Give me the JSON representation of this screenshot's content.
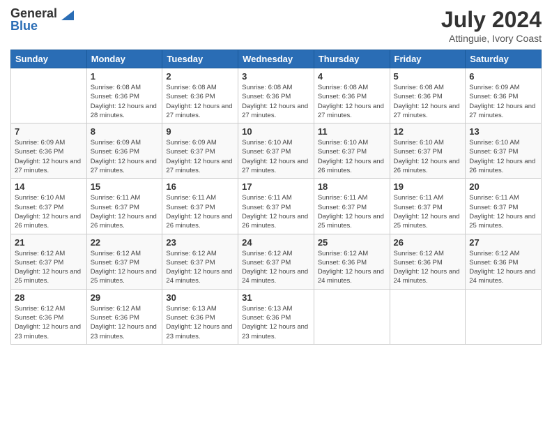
{
  "header": {
    "logo_general": "General",
    "logo_blue": "Blue",
    "month_year": "July 2024",
    "location": "Attinguie, Ivory Coast"
  },
  "calendar": {
    "days_of_week": [
      "Sunday",
      "Monday",
      "Tuesday",
      "Wednesday",
      "Thursday",
      "Friday",
      "Saturday"
    ],
    "weeks": [
      [
        {
          "day": "",
          "sunrise": "",
          "sunset": "",
          "daylight": ""
        },
        {
          "day": "1",
          "sunrise": "Sunrise: 6:08 AM",
          "sunset": "Sunset: 6:36 PM",
          "daylight": "Daylight: 12 hours and 28 minutes."
        },
        {
          "day": "2",
          "sunrise": "Sunrise: 6:08 AM",
          "sunset": "Sunset: 6:36 PM",
          "daylight": "Daylight: 12 hours and 27 minutes."
        },
        {
          "day": "3",
          "sunrise": "Sunrise: 6:08 AM",
          "sunset": "Sunset: 6:36 PM",
          "daylight": "Daylight: 12 hours and 27 minutes."
        },
        {
          "day": "4",
          "sunrise": "Sunrise: 6:08 AM",
          "sunset": "Sunset: 6:36 PM",
          "daylight": "Daylight: 12 hours and 27 minutes."
        },
        {
          "day": "5",
          "sunrise": "Sunrise: 6:08 AM",
          "sunset": "Sunset: 6:36 PM",
          "daylight": "Daylight: 12 hours and 27 minutes."
        },
        {
          "day": "6",
          "sunrise": "Sunrise: 6:09 AM",
          "sunset": "Sunset: 6:36 PM",
          "daylight": "Daylight: 12 hours and 27 minutes."
        }
      ],
      [
        {
          "day": "7",
          "sunrise": "Sunrise: 6:09 AM",
          "sunset": "Sunset: 6:36 PM",
          "daylight": "Daylight: 12 hours and 27 minutes."
        },
        {
          "day": "8",
          "sunrise": "Sunrise: 6:09 AM",
          "sunset": "Sunset: 6:36 PM",
          "daylight": "Daylight: 12 hours and 27 minutes."
        },
        {
          "day": "9",
          "sunrise": "Sunrise: 6:09 AM",
          "sunset": "Sunset: 6:37 PM",
          "daylight": "Daylight: 12 hours and 27 minutes."
        },
        {
          "day": "10",
          "sunrise": "Sunrise: 6:10 AM",
          "sunset": "Sunset: 6:37 PM",
          "daylight": "Daylight: 12 hours and 27 minutes."
        },
        {
          "day": "11",
          "sunrise": "Sunrise: 6:10 AM",
          "sunset": "Sunset: 6:37 PM",
          "daylight": "Daylight: 12 hours and 26 minutes."
        },
        {
          "day": "12",
          "sunrise": "Sunrise: 6:10 AM",
          "sunset": "Sunset: 6:37 PM",
          "daylight": "Daylight: 12 hours and 26 minutes."
        },
        {
          "day": "13",
          "sunrise": "Sunrise: 6:10 AM",
          "sunset": "Sunset: 6:37 PM",
          "daylight": "Daylight: 12 hours and 26 minutes."
        }
      ],
      [
        {
          "day": "14",
          "sunrise": "Sunrise: 6:10 AM",
          "sunset": "Sunset: 6:37 PM",
          "daylight": "Daylight: 12 hours and 26 minutes."
        },
        {
          "day": "15",
          "sunrise": "Sunrise: 6:11 AM",
          "sunset": "Sunset: 6:37 PM",
          "daylight": "Daylight: 12 hours and 26 minutes."
        },
        {
          "day": "16",
          "sunrise": "Sunrise: 6:11 AM",
          "sunset": "Sunset: 6:37 PM",
          "daylight": "Daylight: 12 hours and 26 minutes."
        },
        {
          "day": "17",
          "sunrise": "Sunrise: 6:11 AM",
          "sunset": "Sunset: 6:37 PM",
          "daylight": "Daylight: 12 hours and 26 minutes."
        },
        {
          "day": "18",
          "sunrise": "Sunrise: 6:11 AM",
          "sunset": "Sunset: 6:37 PM",
          "daylight": "Daylight: 12 hours and 25 minutes."
        },
        {
          "day": "19",
          "sunrise": "Sunrise: 6:11 AM",
          "sunset": "Sunset: 6:37 PM",
          "daylight": "Daylight: 12 hours and 25 minutes."
        },
        {
          "day": "20",
          "sunrise": "Sunrise: 6:11 AM",
          "sunset": "Sunset: 6:37 PM",
          "daylight": "Daylight: 12 hours and 25 minutes."
        }
      ],
      [
        {
          "day": "21",
          "sunrise": "Sunrise: 6:12 AM",
          "sunset": "Sunset: 6:37 PM",
          "daylight": "Daylight: 12 hours and 25 minutes."
        },
        {
          "day": "22",
          "sunrise": "Sunrise: 6:12 AM",
          "sunset": "Sunset: 6:37 PM",
          "daylight": "Daylight: 12 hours and 25 minutes."
        },
        {
          "day": "23",
          "sunrise": "Sunrise: 6:12 AM",
          "sunset": "Sunset: 6:37 PM",
          "daylight": "Daylight: 12 hours and 24 minutes."
        },
        {
          "day": "24",
          "sunrise": "Sunrise: 6:12 AM",
          "sunset": "Sunset: 6:37 PM",
          "daylight": "Daylight: 12 hours and 24 minutes."
        },
        {
          "day": "25",
          "sunrise": "Sunrise: 6:12 AM",
          "sunset": "Sunset: 6:36 PM",
          "daylight": "Daylight: 12 hours and 24 minutes."
        },
        {
          "day": "26",
          "sunrise": "Sunrise: 6:12 AM",
          "sunset": "Sunset: 6:36 PM",
          "daylight": "Daylight: 12 hours and 24 minutes."
        },
        {
          "day": "27",
          "sunrise": "Sunrise: 6:12 AM",
          "sunset": "Sunset: 6:36 PM",
          "daylight": "Daylight: 12 hours and 24 minutes."
        }
      ],
      [
        {
          "day": "28",
          "sunrise": "Sunrise: 6:12 AM",
          "sunset": "Sunset: 6:36 PM",
          "daylight": "Daylight: 12 hours and 23 minutes."
        },
        {
          "day": "29",
          "sunrise": "Sunrise: 6:12 AM",
          "sunset": "Sunset: 6:36 PM",
          "daylight": "Daylight: 12 hours and 23 minutes."
        },
        {
          "day": "30",
          "sunrise": "Sunrise: 6:13 AM",
          "sunset": "Sunset: 6:36 PM",
          "daylight": "Daylight: 12 hours and 23 minutes."
        },
        {
          "day": "31",
          "sunrise": "Sunrise: 6:13 AM",
          "sunset": "Sunset: 6:36 PM",
          "daylight": "Daylight: 12 hours and 23 minutes."
        },
        {
          "day": "",
          "sunrise": "",
          "sunset": "",
          "daylight": ""
        },
        {
          "day": "",
          "sunrise": "",
          "sunset": "",
          "daylight": ""
        },
        {
          "day": "",
          "sunrise": "",
          "sunset": "",
          "daylight": ""
        }
      ]
    ]
  }
}
